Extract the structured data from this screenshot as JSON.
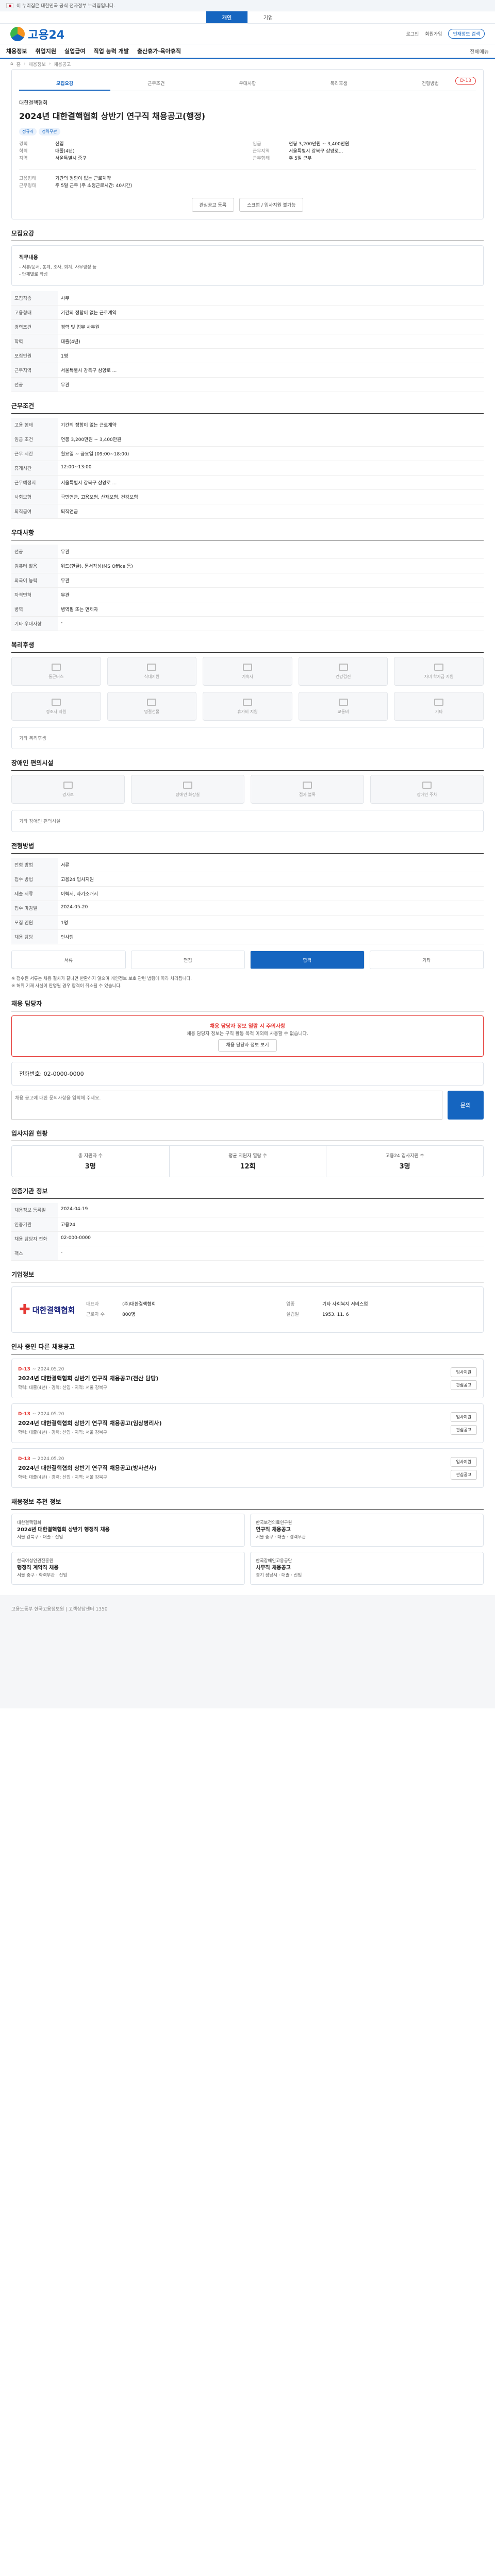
{
  "gov_bar": "이 누리집은 대한민국 공식 전자정부 누리집입니다.",
  "top_tabs": [
    "개인",
    "기업"
  ],
  "logo": "고용24",
  "header_right": [
    "로그인",
    "회원가입",
    "인재정보 검색"
  ],
  "main_nav": [
    "채용정보",
    "취업지원",
    "실업급여",
    "직업 능력 개발",
    "출산휴가·육아휴직"
  ],
  "nav_right": [
    "전체메뉴"
  ],
  "crumb": [
    "홈",
    "채용정보",
    "채용공고"
  ],
  "detail_tabs": [
    "모집요강",
    "근무조건",
    "우대사항",
    "복리후생",
    "전형방법"
  ],
  "job": {
    "company": "대한결핵협회",
    "title": "2024년 대한결핵협회 상반기 연구직 채용공고(행정)",
    "dday": "D-13",
    "badges": [
      "정규직",
      "경력무관"
    ],
    "left": [
      [
        "경력",
        "신입"
      ],
      [
        "학력",
        "대졸(4년)"
      ],
      [
        "지역",
        "서울특별시 중구"
      ]
    ],
    "right": [
      [
        "임금",
        "연봉 3,200만원 ~ 3,400만원"
      ],
      [
        "근무지역",
        "서울특별시 강북구 삼양로..."
      ],
      [
        "근무형태",
        "주 5일 근무"
      ]
    ],
    "company_info": [
      [
        "고용형태",
        "기간의 정함이 없는 근로계약"
      ],
      [
        "근무형태",
        "주 5일 근무 (주 소정근로시간: 40시간)"
      ]
    ],
    "apply_btn": "관심공고 등록",
    "scrap_btn": "스크랩 / 입사지원 불가능"
  },
  "sections": {
    "recruit": "모집요강",
    "recruit_duty": "직무내용",
    "recruit_duty_text": "- 서류/문서, 통계, 조사, 회계, 사무행정 등\n- 단체별로 작성",
    "recruit_rows": [
      [
        "모집직종",
        "사무"
      ],
      [
        "고용형태",
        "기간의 정함이 없는 근로계약"
      ],
      [
        "경력조건",
        "경력 및 업무 사무원"
      ],
      [
        "학력",
        "대졸(4년)"
      ],
      [
        "모집인원",
        "1명"
      ],
      [
        "근무지역",
        "서울특별시 강북구 삼양로 ..."
      ],
      [
        "전공",
        "무관"
      ]
    ],
    "cond": "근무조건",
    "cond_rows": [
      [
        "고용 형태",
        "기간의 정함이 없는 근로계약"
      ],
      [
        "임금 조건",
        "연봉 3,200만원 ~ 3,400만원"
      ],
      [
        "근무 시간",
        "월요일 ~ 금요일 (09:00~18:00)"
      ],
      [
        "휴게시간",
        "12:00~13:00"
      ],
      [
        "근무예정지",
        "서울특별시 강북구 삼양로 ..."
      ],
      [
        "사회보험",
        "국민연금, 고용보험, 산재보험, 건강보험"
      ],
      [
        "퇴직급여",
        "퇴직연금"
      ]
    ],
    "pref": "우대사항",
    "pref_rows": [
      [
        "전공",
        "무관"
      ],
      [
        "컴퓨터 활용",
        "워드(한글), 문서작성(MS Office 등)"
      ],
      [
        "외국어 능력",
        "무관"
      ],
      [
        "자격면허",
        "무관"
      ],
      [
        "병역",
        "병역필 또는 면제자"
      ],
      [
        "기타 우대사항",
        "-"
      ]
    ],
    "welfare": "복리후생",
    "welfare_items": [
      "통근버스",
      "식대지원",
      "기숙사",
      "건강검진",
      "자녀 학자금 지원",
      "경조사 지원",
      "명절선물",
      "휴가비 지원",
      "교통비",
      "기타"
    ],
    "welfare_etc": "기타 복리후생",
    "disability": "장애인 편의시설",
    "disability_items": [
      "경사로",
      "장애인 화장실",
      "점자 블록",
      "장애인 주차"
    ],
    "disability_etc": "기타 장애인 편의시설",
    "selection": "전형방법",
    "selection_rows": [
      [
        "전형 방법",
        "서류"
      ],
      [
        "접수 방법",
        "고용24 입사지원"
      ],
      [
        "제출 서류",
        "이력서, 자기소개서"
      ],
      [
        "접수 마감일",
        "2024-05-20"
      ],
      [
        "모집 인원",
        "1명"
      ],
      [
        "채용 담당",
        "인사팀"
      ]
    ],
    "steps": [
      "서류",
      "면접",
      "합격",
      "기타"
    ],
    "notice": "※ 접수된 서류는 채용 절차가 끝나면 반환하지 않으며 개인정보 보호 관련 법령에 따라 처리됩니다.\n※ 허위 기재 사실이 판명될 경우 합격이 취소될 수 있습니다.",
    "inquiry": "채용 담당자",
    "alert_title": "채용 담당자 정보 열람 시 주의사항",
    "alert_text": "채용 담당자 정보는 구직 활동 목적 이외에 사용할 수 없습니다.",
    "alert_btn": "채용 담당자 정보 보기",
    "phone": "전화번호: 02-0000-0000",
    "inq_placeholder": "채용 공고에 대한 문의사항을 입력해 주세요.",
    "inq_send": "문의",
    "stats_h": "입사지원 현황",
    "stats": [
      [
        "총 지원자 수",
        "3명"
      ],
      [
        "평균 지원자 열람 수",
        "12회"
      ],
      [
        "고용24 입사지원 수",
        "3명"
      ]
    ],
    "agency": "인증기관 정보",
    "agency_rows": [
      [
        "채용정보 등록일",
        "2024-04-19"
      ],
      [
        "인증기관",
        "고용24"
      ],
      [
        "채용 담당자 전화",
        "02-000-0000"
      ],
      [
        "팩스",
        "-"
      ]
    ],
    "corp": "기업정보",
    "corp_name": "대한결핵협회",
    "corp_rows": [
      [
        "대표자",
        "(주)대한결핵협회"
      ],
      [
        "업종",
        "기타 사회복지 서비스업"
      ],
      [
        "근로자 수",
        "800명"
      ],
      [
        "설립일",
        "1953. 11. 6"
      ]
    ],
    "others": "인사 중인 다른 채용공고",
    "rec": "채용정보 추천 정보"
  },
  "other_jobs": [
    {
      "dday": "D-13",
      "date": "~ 2024.05.20",
      "title": "2024년 대한결핵협회 상반기 연구직 채용공고(전산 담당)",
      "meta": "학력: 대졸(4년) · 경력: 신입 · 지역: 서울 강북구"
    },
    {
      "dday": "D-13",
      "date": "~ 2024.05.20",
      "title": "2024년 대한결핵협회 상반기 연구직 채용공고(임상병리사)",
      "meta": "학력: 대졸(4년) · 경력: 신입 · 지역: 서울 강북구"
    },
    {
      "dday": "D-13",
      "date": "~ 2024.05.20",
      "title": "2024년 대한결핵협회 상반기 연구직 채용공고(방사선사)",
      "meta": "학력: 대졸(4년) · 경력: 신입 · 지역: 서울 강북구"
    }
  ],
  "other_btns": [
    "입사지원",
    "관심공고"
  ],
  "recs": [
    {
      "co": "대한결핵협회",
      "title": "2024년 대한결핵협회 상반기 행정직 채용",
      "meta": "서울 강북구 · 대졸 · 신입"
    },
    {
      "co": "한국보건의료연구원",
      "title": "연구직 채용공고",
      "meta": "서울 중구 · 대졸 · 경력무관"
    },
    {
      "co": "한국여성인권진흥원",
      "title": "행정직 계약직 채용",
      "meta": "서울 중구 · 학력무관 · 신입"
    },
    {
      "co": "한국장애인고용공단",
      "title": "사무직 채용공고",
      "meta": "경기 성남시 · 대졸 · 신입"
    }
  ],
  "footer": "고용노동부 한국고용정보원 | 고객상담센터 1350"
}
